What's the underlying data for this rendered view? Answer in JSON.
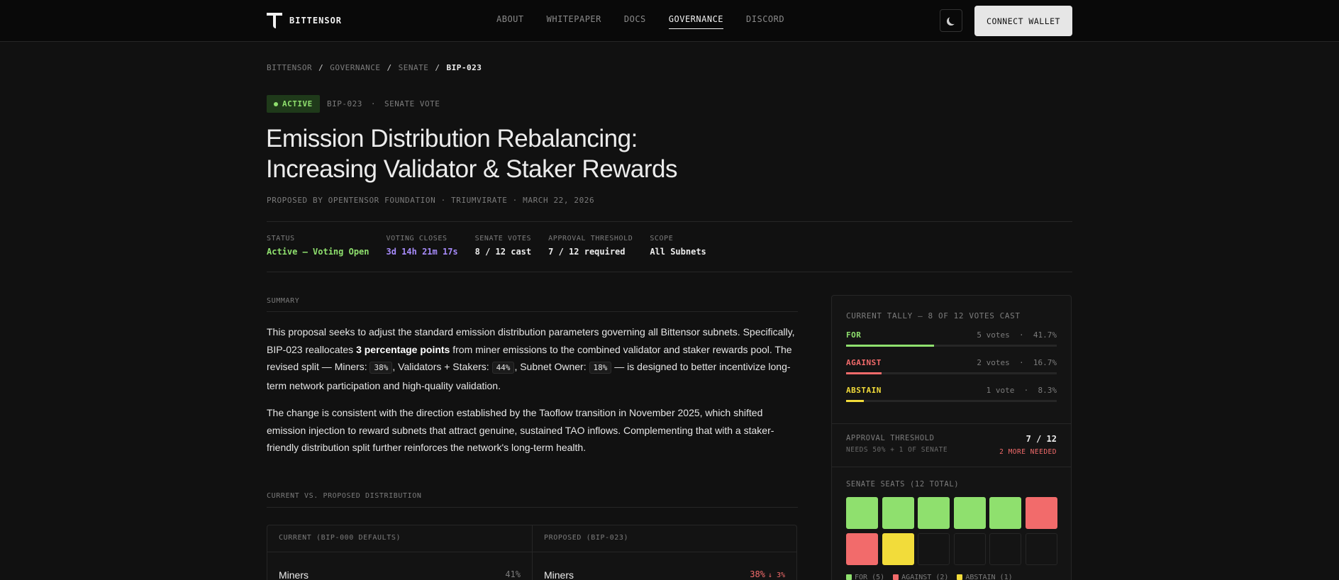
{
  "nav": {
    "brand": "BITTENSOR",
    "links": [
      "ABOUT",
      "WHITEPAPER",
      "DOCS",
      "GOVERNANCE",
      "DISCORD"
    ],
    "active": "GOVERNANCE",
    "connect_label": "CONNECT WALLET",
    "theme_icon": "moon-icon"
  },
  "breadcrumb": [
    "BITTENSOR",
    "GOVERNANCE",
    "SENATE",
    "BIP-023"
  ],
  "proposal": {
    "status_badge": "ACTIVE",
    "id": "BIP-023",
    "dot": "·",
    "kind": "SENATE VOTE",
    "title_line1": "Emission Distribution Rebalancing:",
    "title_line2": "Increasing Validator & Staker Rewards",
    "byline": "PROPOSED BY OPENTENSOR FOUNDATION · TRIUMVIRATE · MARCH 22, 2026"
  },
  "stats": [
    {
      "label": "STATUS",
      "value": "Active — Voting Open",
      "tone": "green"
    },
    {
      "label": "VOTING CLOSES",
      "value": "3d 14h 21m 17s",
      "tone": "purple"
    },
    {
      "label": "SENATE VOTES",
      "value": "8 / 12 cast",
      "tone": "default"
    },
    {
      "label": "APPROVAL THRESHOLD",
      "value": "7 / 12 required",
      "tone": "default"
    },
    {
      "label": "SCOPE",
      "value": "All Subnets",
      "tone": "default"
    }
  ],
  "summary": {
    "label": "SUMMARY",
    "p1_a": "This proposal seeks to adjust the standard emission distribution parameters governing all Bittensor subnets. Specifically, BIP-023 reallocates ",
    "p1_bold": "3 percentage points",
    "p1_b": " from miner emissions to the combined validator and staker rewards pool. The revised split — Miners: ",
    "miners_code": "38%",
    "p1_c": ", Validators + Stakers: ",
    "validators_code": "44%",
    "p1_d": ", Subnet Owner: ",
    "owner_code": "18%",
    "p1_e": " — is designed to better incentivize long-term network participation and high-quality validation.",
    "p2": "The change is consistent with the direction established by the Taoflow transition in November 2025, which shifted emission injection to reward subnets that attract genuine, sustained TAO inflows. Complementing that with a staker-friendly distribution split further reinforces the network's long-term health."
  },
  "distribution": {
    "label": "CURRENT VS. PROPOSED DISTRIBUTION",
    "current_head": "CURRENT (BIP-000 DEFAULTS)",
    "proposed_head": "PROPOSED (BIP-023)",
    "current_row": {
      "name": "Miners",
      "pct": "41%"
    },
    "proposed_row": {
      "name": "Miners",
      "pct": "38%",
      "delta": "↓ 3%"
    }
  },
  "tally": {
    "title": "CURRENT TALLY — 8 OF 12 VOTES CAST",
    "rows": [
      {
        "name": "FOR",
        "votes": "5 votes",
        "pct": "41.7%",
        "share": 0.417,
        "color": "#8fe06e"
      },
      {
        "name": "AGAINST",
        "votes": "2 votes",
        "pct": "16.7%",
        "share": 0.167,
        "color": "#f26b6b"
      },
      {
        "name": "ABSTAIN",
        "votes": "1 vote",
        "pct": "8.3%",
        "share": 0.083,
        "color": "#f2dc3a"
      }
    ],
    "sep": "·",
    "threshold_label": "APPROVAL THRESHOLD",
    "threshold_sub": "NEEDS 50% + 1 OF SENATE",
    "threshold_value": "7 / 12",
    "threshold_need": "2 MORE NEEDED",
    "seats_title": "SENATE SEATS (12 TOTAL)",
    "seats": [
      "for",
      "for",
      "for",
      "for",
      "for",
      "against",
      "against",
      "abstain",
      "empty",
      "empty",
      "empty",
      "empty"
    ],
    "seat_colors": {
      "for": "#8fe06e",
      "against": "#f26b6b",
      "abstain": "#f2dc3a",
      "empty": "#141414"
    },
    "legend": [
      {
        "label": "FOR (5)",
        "color": "#8fe06e"
      },
      {
        "label": "AGAINST (2)",
        "color": "#f26b6b"
      },
      {
        "label": "ABSTAIN (1)",
        "color": "#f2dc3a"
      }
    ]
  }
}
